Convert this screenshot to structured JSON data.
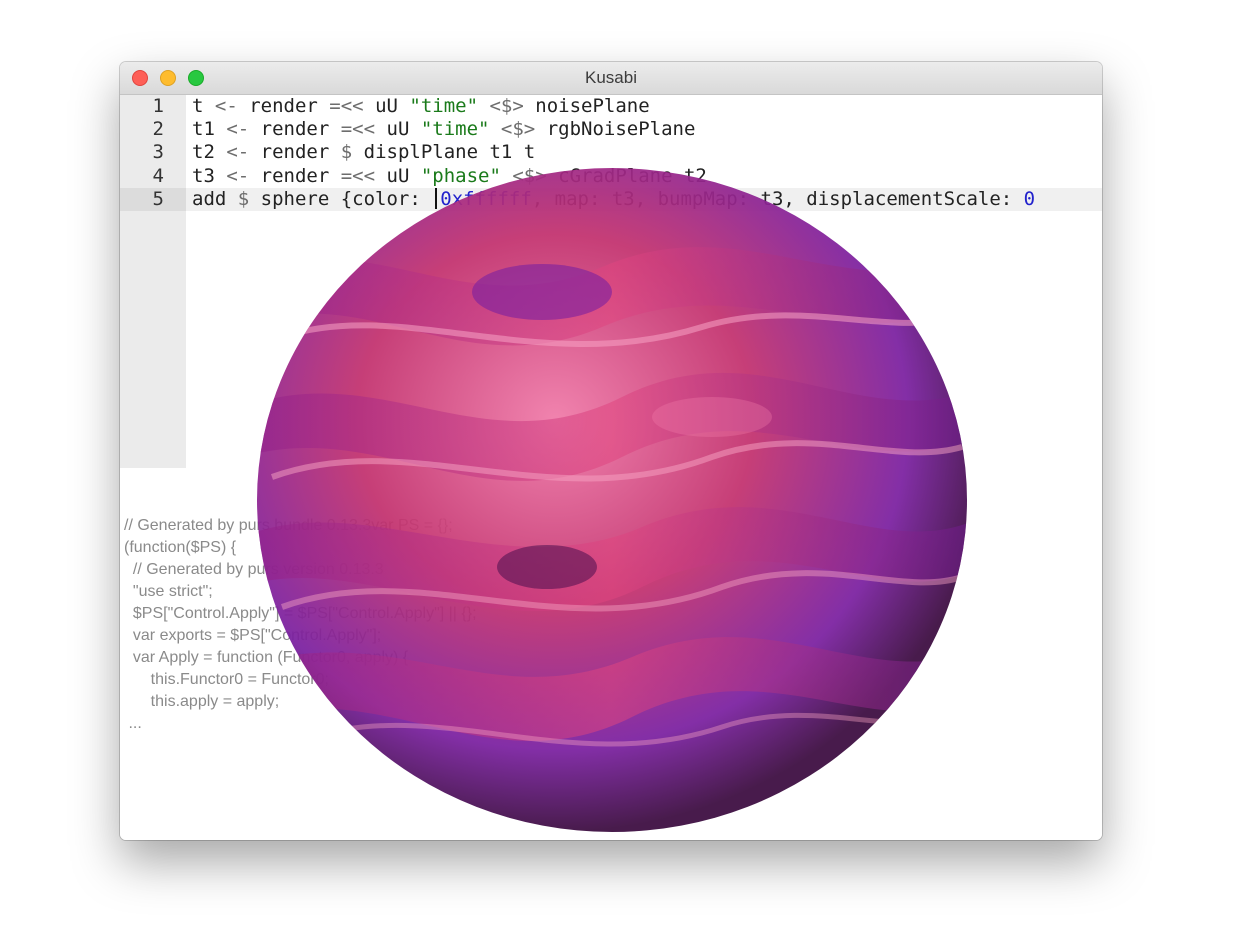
{
  "window": {
    "title": "Kusabi"
  },
  "editor": {
    "line_numbers": [
      "1",
      "2",
      "3",
      "4",
      "5"
    ],
    "lines": [
      {
        "tokens": [
          "t ",
          "<-",
          " render ",
          "=<<",
          " uU ",
          "\"time\"",
          " ",
          "<$>",
          " noisePlane"
        ]
      },
      {
        "tokens": [
          "t1 ",
          "<-",
          " render ",
          "=<<",
          " uU ",
          "\"time\"",
          " ",
          "<$>",
          " rgbNoisePlane"
        ]
      },
      {
        "tokens": [
          "t2 ",
          "<-",
          " render ",
          "$",
          " displPlane t1 t"
        ]
      },
      {
        "tokens": [
          "t3 ",
          "<-",
          " render ",
          "=<<",
          " uU ",
          "\"phase\"",
          " ",
          "<$>",
          " cGradPlane t2"
        ]
      },
      {
        "tokens": [
          "add ",
          "$",
          " sphere {color: ",
          "0xffffff",
          ", map: t3, bumpMap: t3, displacementScale: ",
          "0"
        ]
      }
    ],
    "active_line": "5"
  },
  "output": {
    "lines": [
      "// Generated by purs bundle 0.13.3var PS = {};",
      "(function($PS) {",
      "  // Generated by purs version 0.13.3",
      "  \"use strict\";",
      "  $PS[\"Control.Apply\"] = $PS[\"Control.Apply\"] || {};",
      "  var exports = $PS[\"Control.Apply\"];",
      "  var Apply = function (Functor0, apply) {",
      "      this.Functor0 = Functor0;",
      "      this.apply = apply;",
      " ..."
    ]
  },
  "scene": {
    "object": "sphere",
    "colors": {
      "primary": "#c2306d",
      "secondary": "#7a1fa0",
      "highlight": "#f07aa8",
      "shadow": "#3a0a3e"
    }
  }
}
